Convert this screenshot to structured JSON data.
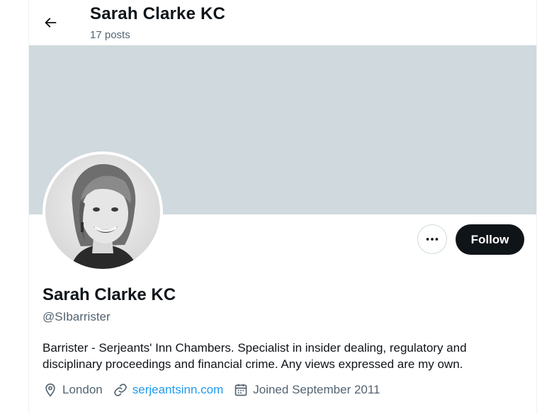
{
  "header": {
    "title": "Sarah Clarke KC",
    "post_count": "17 posts",
    "back_icon": "arrow-left-icon"
  },
  "profile": {
    "name": "Sarah Clarke KC",
    "handle": "@SIbarrister",
    "bio": "Barrister - Serjeants' Inn Chambers. Specialist in insider dealing, regulatory and disciplinary proceedings and financial crime. Any views expressed are my own.",
    "location": "London",
    "website": "serjeantsinn.com",
    "joined": "Joined September 2011"
  },
  "actions": {
    "follow_label": "Follow",
    "more_icon": "more-options-icon"
  },
  "colors": {
    "banner": "#cfd9de",
    "link": "#1d9bf0",
    "follow_bg": "#0f1419",
    "secondary_text": "#536471"
  }
}
